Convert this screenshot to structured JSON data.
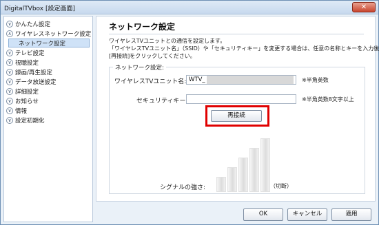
{
  "window": {
    "title": "DigitalTVbox [設定画面]",
    "close_symbol": "✕"
  },
  "sidebar": {
    "items": [
      {
        "label": "かんたん設定",
        "chevron": "∨"
      },
      {
        "label": "ワイヤレスネットワーク設定",
        "chevron": "∧"
      },
      {
        "label": "ネットワーク設定",
        "sub": true
      },
      {
        "label": "テレビ設定",
        "chevron": "∨"
      },
      {
        "label": "視聴設定",
        "chevron": "∨"
      },
      {
        "label": "録画/再生設定",
        "chevron": "∨"
      },
      {
        "label": "データ放送設定",
        "chevron": "∨"
      },
      {
        "label": "詳細設定",
        "chevron": "∨"
      },
      {
        "label": "お知らせ",
        "chevron": "∨"
      },
      {
        "label": "情報",
        "chevron": "∨"
      },
      {
        "label": "設定初期化",
        "chevron": "∨"
      }
    ]
  },
  "main": {
    "title": "ネットワーク設定",
    "description": [
      "ワイヤレスTVユニットとの通信を設定します。",
      "「ワイヤレスTVユニット名」（SSID）や「セキュリティキー」を変更する場合は、任意の名称とキーを入力後、",
      "[再接続]をクリックしてください。"
    ],
    "group_label": "ネットワーク設定:",
    "unit_name": {
      "label": "ワイヤレスTVユニット名:",
      "value": "WTV_",
      "hint": "※半角英数"
    },
    "security_key": {
      "label": "セキュリティキー:",
      "value": "",
      "hint": "※半角英数8文字以上"
    },
    "reconnect_label": "再接続",
    "signal": {
      "label": "シグナルの強さ:",
      "status": "（切断）",
      "level": 0,
      "bars": 5
    }
  },
  "footer": {
    "ok_label": "OK",
    "cancel_label": "キャンセル",
    "apply_label": "適用"
  },
  "colors": {
    "highlight": "#e00000",
    "selected_bg": "#cfe2f7"
  }
}
